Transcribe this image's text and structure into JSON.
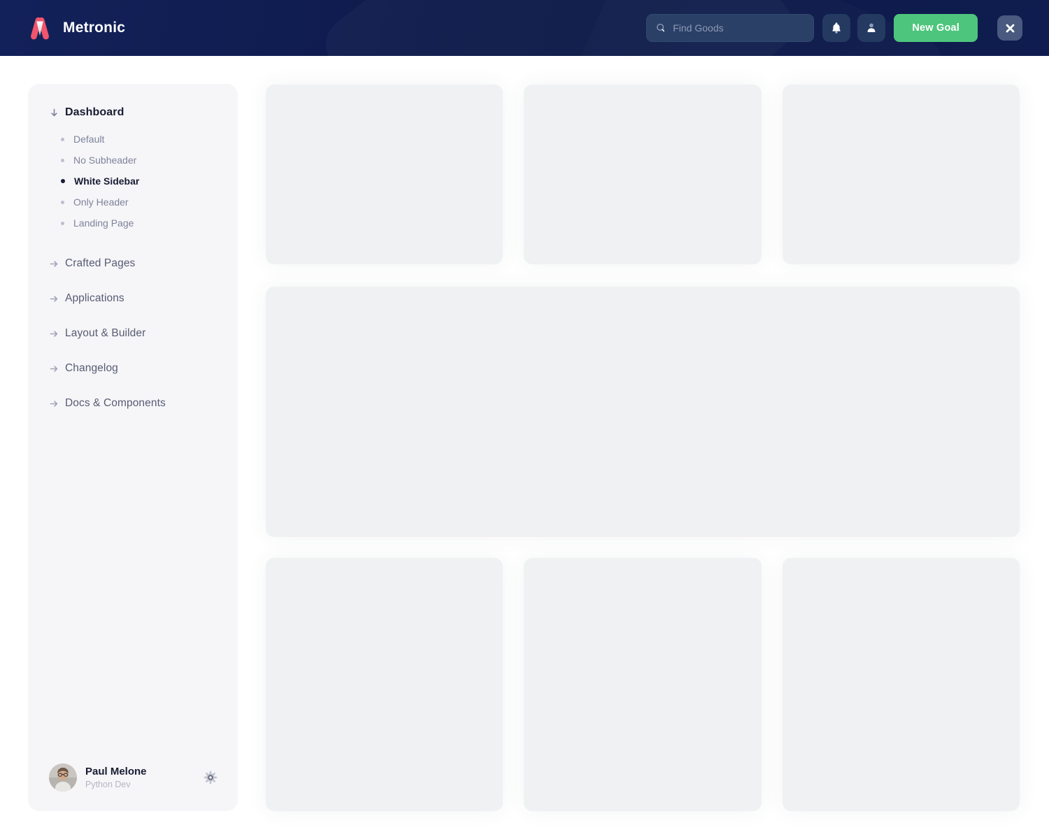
{
  "header": {
    "brand": "Metronic",
    "search": {
      "placeholder": "Find Goods"
    },
    "new_goal_label": "New Goal",
    "icons": [
      "magnifier-icon",
      "bell-icon",
      "person-icon",
      "close-x-icon"
    ]
  },
  "sidebar": {
    "dashboard": {
      "label": "Dashboard",
      "expanded": true,
      "children": [
        {
          "label": "Default",
          "active": false
        },
        {
          "label": "No Subheader",
          "active": false
        },
        {
          "label": "White Sidebar",
          "active": true
        },
        {
          "label": "Only Header",
          "active": false
        },
        {
          "label": "Landing Page",
          "active": false
        }
      ]
    },
    "sections": [
      {
        "label": "Crafted Pages"
      },
      {
        "label": "Applications"
      },
      {
        "label": "Layout & Builder"
      },
      {
        "label": "Changelog"
      },
      {
        "label": "Docs & Components"
      }
    ],
    "user": {
      "name": "Paul Melone",
      "role": "Python Dev"
    }
  },
  "main": {
    "placeholder_cards": {
      "top_row": 3,
      "featured_wide": 1,
      "bottom_row": 3
    }
  },
  "colors": {
    "header_navy": "#0d1947",
    "accent_green": "#4ec57d",
    "brand_red": "#f1556c",
    "sidebar_bg": "#f6f6f9",
    "card_gray": "#f0f1f3",
    "text_dark": "#181c32",
    "text_muted": "#7e8299"
  }
}
